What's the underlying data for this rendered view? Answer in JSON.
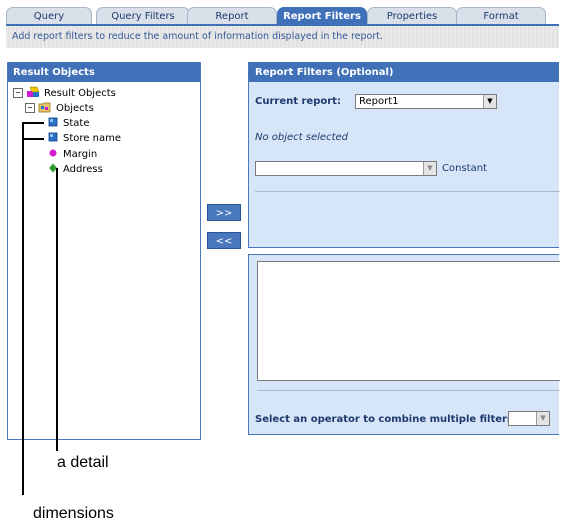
{
  "tabs": [
    {
      "label": "Query",
      "active": false
    },
    {
      "label": "Query Filters",
      "active": false
    },
    {
      "label": "Report",
      "active": false
    },
    {
      "label": "Report Filters",
      "active": true
    },
    {
      "label": "Properties",
      "active": false
    },
    {
      "label": "Format",
      "active": false
    }
  ],
  "hint": "Add report filters to reduce the amount of information displayed in the report.",
  "result_objects": {
    "title": "Result Objects",
    "root": {
      "label": "Result Objects",
      "expander": "−",
      "icon": "result-objects-icon"
    },
    "folder": {
      "label": "Objects",
      "expander": "−",
      "icon": "folder-icon"
    },
    "items": [
      {
        "label": "State",
        "icon": "dimension-icon",
        "color": "#2a6fc9"
      },
      {
        "label": "Store name",
        "icon": "dimension-icon",
        "color": "#2a6fc9"
      },
      {
        "label": "Margin",
        "icon": "measure-icon",
        "color": "#d21bd2"
      },
      {
        "label": "Address",
        "icon": "detail-icon",
        "color": "#2e9b2e"
      }
    ]
  },
  "buttons": {
    "add": ">>",
    "remove": "<<"
  },
  "report_filters": {
    "title": "Report Filters (Optional)",
    "current_report_label": "Current report:",
    "current_report_value": "Report1",
    "no_object": "No object selected",
    "operator_value": "",
    "constant_label": "Constant"
  },
  "combine": {
    "label": "Select an operator to combine multiple filters:",
    "value": ""
  },
  "annotations": {
    "detail": "a detail",
    "dimensions": "dimensions"
  },
  "colors": {
    "accent": "#3f70b8",
    "panel_bg": "#d6e5f7"
  }
}
